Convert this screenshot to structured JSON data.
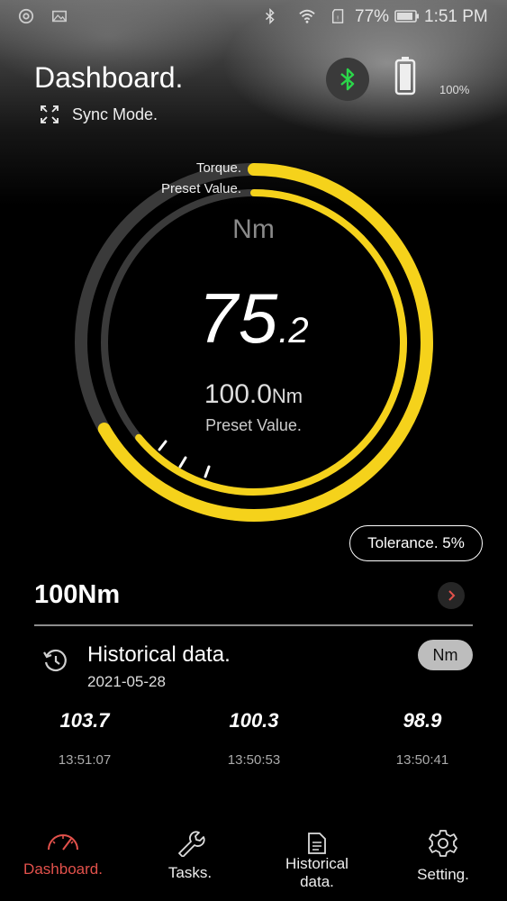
{
  "status_bar": {
    "battery_percent": "77%",
    "time": "1:51 PM"
  },
  "header": {
    "title": "Dashboard.",
    "sync_label": "Sync Mode.",
    "device_battery": "100%"
  },
  "gauge": {
    "torque_label": "Torque.",
    "preset_label": "Preset Value.",
    "unit": "Nm",
    "value_int": "75",
    "value_dec": ".2",
    "preset_value": "100.0",
    "preset_unit": "Nm",
    "preset_caption": "Preset Value.",
    "torque_fraction": 0.752,
    "preset_fraction": 1.0,
    "accent_color": "#f5d21b"
  },
  "tolerance": "Tolerance. 5%",
  "target": "100Nm",
  "history": {
    "title": "Historical data.",
    "date": "2021-05-28",
    "unit_toggle": "Nm",
    "records": [
      {
        "value": "103.7",
        "time": "13:51:07"
      },
      {
        "value": "100.3",
        "time": "13:50:53"
      },
      {
        "value": "98.9",
        "time": "13:50:41"
      }
    ]
  },
  "nav": [
    {
      "label": "Dashboard.",
      "icon": "speedometer-icon",
      "active": true
    },
    {
      "label": "Tasks.",
      "icon": "wrench-icon",
      "active": false
    },
    {
      "label": "Historical\ndata.",
      "icon": "document-icon",
      "active": false
    },
    {
      "label": "Setting.",
      "icon": "gear-icon",
      "active": false
    }
  ]
}
